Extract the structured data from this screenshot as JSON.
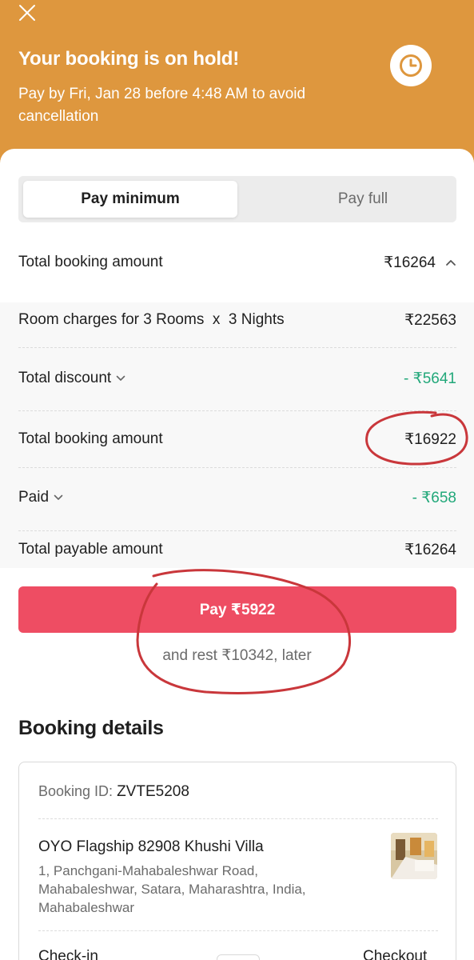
{
  "header": {
    "title": "Your booking is on hold!",
    "subtitle": "Pay by Fri, Jan 28 before 4:48 AM to avoid cancellation",
    "close_icon": "close-icon",
    "clock_icon": "clock-icon",
    "bg_color": "#de973e"
  },
  "payment_toggle": {
    "options": [
      {
        "label": "Pay minimum",
        "selected": true
      },
      {
        "label": "Pay full",
        "selected": false
      }
    ]
  },
  "summary": {
    "total_booking_label": "Total booking amount",
    "total_booking_value": "₹16264",
    "expanded": true
  },
  "breakdown": {
    "rows": [
      {
        "label": "Room charges for 3 Rooms  x  3 Nights",
        "value": "₹22563"
      },
      {
        "label": "Total discount",
        "value": "- ₹5641",
        "has_chevron": true,
        "value_color": "#22a87a"
      },
      {
        "label": "Total booking amount",
        "value": "₹16922"
      },
      {
        "label": "Paid",
        "value": "- ₹658",
        "has_chevron": true,
        "value_color": "#22a87a"
      },
      {
        "label": "Total payable amount",
        "value": "₹16264"
      }
    ]
  },
  "pay_button": {
    "label": "Pay ₹5922",
    "color": "#ee4d63"
  },
  "rest_note": "and rest ₹10342, later",
  "booking_details": {
    "title": "Booking details",
    "booking_id_label": "Booking ID:",
    "booking_id": "ZVTE5208",
    "hotel_name": "OYO Flagship 82908 Khushi Villa",
    "hotel_address": "1, Panchgani-Mahabaleshwar Road, Mahabaleshwar, Satara, Maharashtra, India, Mahabaleshwar",
    "checkin_label": "Check-in",
    "checkout_label": "Checkout"
  }
}
